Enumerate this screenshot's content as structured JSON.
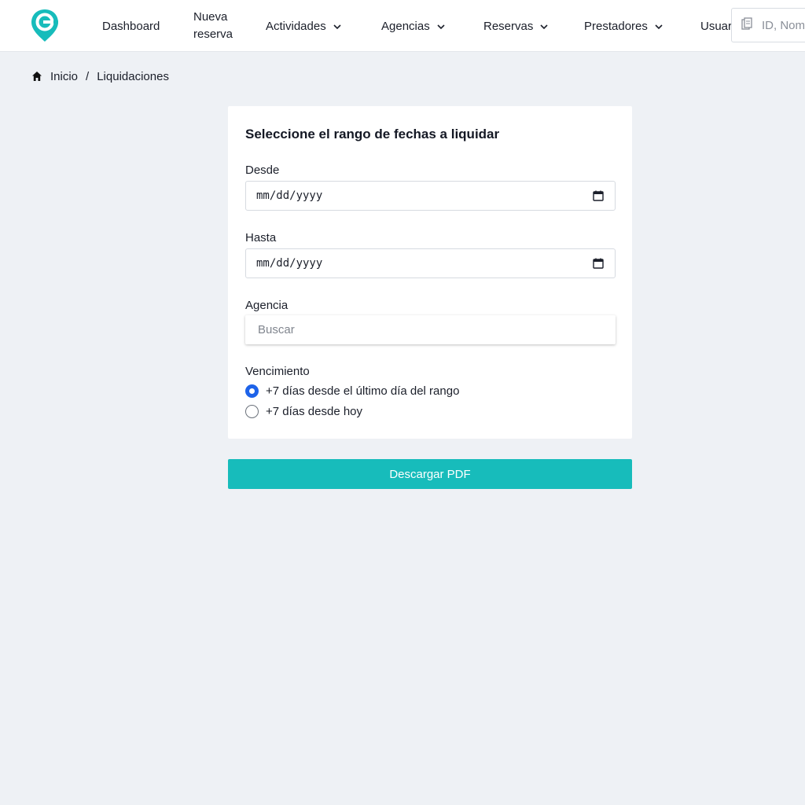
{
  "header": {
    "nav": [
      {
        "label": "Dashboard"
      },
      {
        "label_line1": "Nueva",
        "label_line2": "reserva"
      },
      {
        "label": "Actividades"
      },
      {
        "label": "Agencias"
      },
      {
        "label": "Reservas"
      },
      {
        "label": "Prestadores"
      },
      {
        "label": "Usuar"
      }
    ],
    "search_placeholder": "ID, Nom"
  },
  "breadcrumb": {
    "home": "Inicio",
    "separator": "/",
    "current": "Liquidaciones"
  },
  "form": {
    "title": "Seleccione el rango de fechas a liquidar",
    "from_label": "Desde",
    "from_value": "mm/dd/yyyy",
    "to_label": "Hasta",
    "to_value": "mm/dd/yyyy",
    "agency_label": "Agencia",
    "agency_placeholder": "Buscar",
    "due_label": "Vencimiento",
    "due_options": [
      {
        "label": "+7 días desde el último día del rango",
        "selected": true
      },
      {
        "label": "+7 días desde hoy",
        "selected": false
      }
    ],
    "download_button": "Descargar PDF"
  },
  "colors": {
    "brand": "#17bcbb",
    "radio_selected": "#1e63e9",
    "background": "#eef1f5"
  }
}
